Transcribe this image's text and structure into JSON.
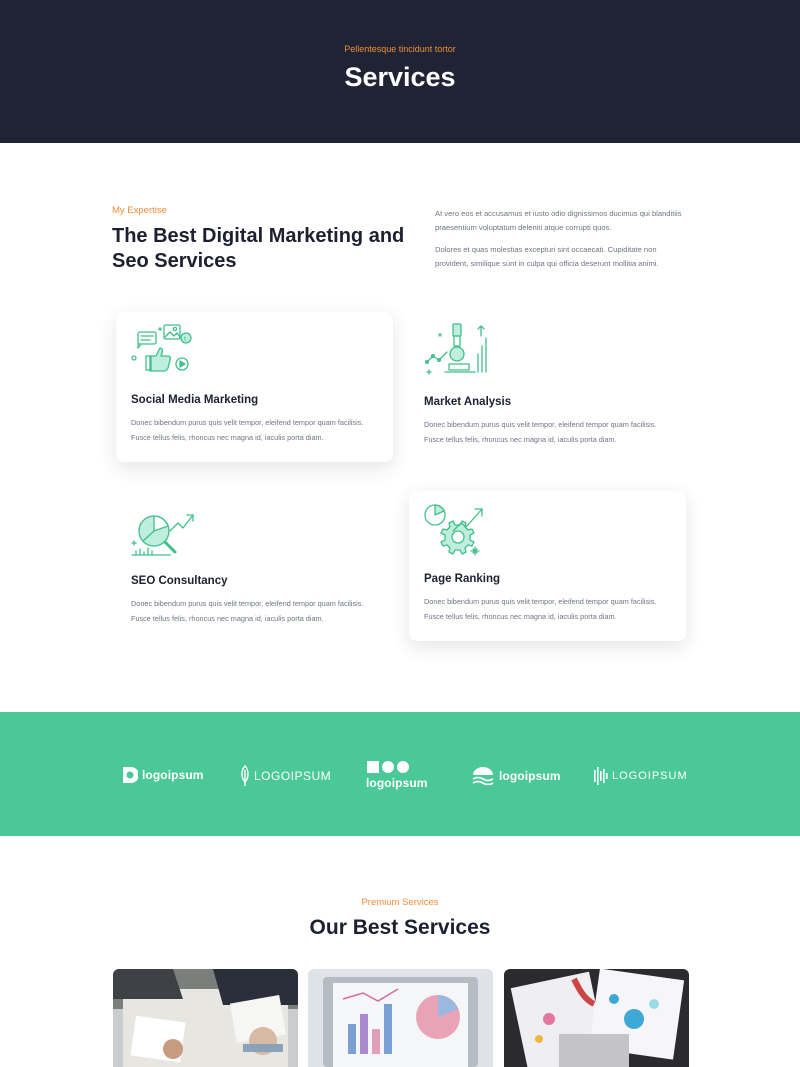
{
  "hero": {
    "eyebrow": "Pellentesque tincidunt tortor",
    "title": "Services"
  },
  "intro": {
    "eyebrow": "My Expertise",
    "title": "The Best Digital Marketing and Seo Services",
    "paragraph1": "At vero eos et accusamus et iusto odio dignissimos ducimus qui blanditiis praesentium voluptatum deleniti atque corrupti quos.",
    "paragraph2": "Dolores et quas molestias excepturi sint occaecati. Cupiditate non provident, similique sunt in culpa qui officia deserunt mollitia animi."
  },
  "services": [
    {
      "title": "Social Media Marketing",
      "text": "Donec bibendum purus quis velit tempor, eleifend tempor quam facilisis. Fusce tellus felis, rhoncus nec magna id, iaculis porta diam.",
      "icon": "social-media-icon"
    },
    {
      "title": "Market Analysis",
      "text": "Donec bibendum purus quis velit tempor, eleifend tempor quam facilisis. Fusce tellus felis, rhoncus nec magna id, iaculis porta diam.",
      "icon": "microscope-chart-icon"
    },
    {
      "title": "SEO Consultancy",
      "text": "Donec bibendum purus quis velit tempor, eleifend tempor quam facilisis. Fusce tellus felis, rhoncus nec magna id, iaculis porta diam.",
      "icon": "magnifier-chart-icon"
    },
    {
      "title": "Page Ranking",
      "text": "Donec bibendum purus quis velit tempor, eleifend tempor quam facilisis. Fusce tellus felis, rhoncus nec magna id, iaculis porta diam.",
      "icon": "gear-growth-icon"
    }
  ],
  "logos": [
    {
      "text": "logoipsum",
      "icon": "logo-mark-icon"
    },
    {
      "text": "LOGOIPSUM",
      "icon": "feather-logo-icon"
    },
    {
      "text": "logoipsum",
      "icon": "shapes-logo-icon"
    },
    {
      "text": "logoipsum",
      "icon": "wave-logo-icon"
    },
    {
      "text": "LOGOIPSUM",
      "icon": "bars-logo-icon"
    }
  ],
  "premium": {
    "eyebrow": "Premium Services",
    "title": "Our Best Services"
  },
  "colors": {
    "dark": "#1f2333",
    "accent_orange": "#f28c38",
    "accent_green": "#4bc897"
  }
}
